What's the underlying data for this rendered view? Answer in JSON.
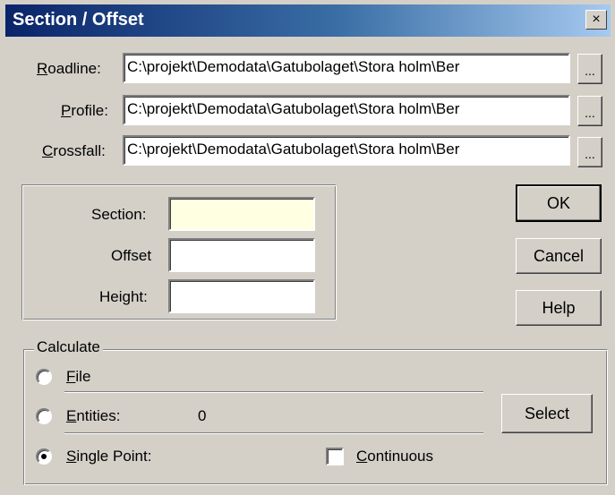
{
  "window": {
    "title": "Section / Offset",
    "close_glyph": "×"
  },
  "files": {
    "roadline_label_key": "R",
    "roadline_label_rest": "oadline:",
    "roadline_value": "C:\\projekt\\Demodata\\Gatubolaget\\Stora holm\\Ber",
    "profile_label_key": "P",
    "profile_label_rest": "rofile:",
    "profile_value": "C:\\projekt\\Demodata\\Gatubolaget\\Stora holm\\Ber",
    "crossfall_label_key": "C",
    "crossfall_label_rest": "rossfall:",
    "crossfall_value": "C:\\projekt\\Demodata\\Gatubolaget\\Stora holm\\Ber",
    "browse_label": "..."
  },
  "position": {
    "section_label": "Section:",
    "section_value": "",
    "offset_label": "Offset",
    "offset_value": "",
    "height_label": "Height:",
    "height_value": ""
  },
  "buttons": {
    "ok": "OK",
    "cancel": "Cancel",
    "help": "Help",
    "select": "Select"
  },
  "calculate": {
    "group_label": "Calculate",
    "file_key": "F",
    "file_rest": "ile",
    "entities_key": "E",
    "entities_rest": "ntities:",
    "entities_count": "0",
    "single_point_key": "S",
    "single_point_rest": "ingle Point:",
    "continuous_key": "C",
    "continuous_rest": "ontinuous",
    "selected_option": "Single Point",
    "continuous_checked": false
  },
  "colors": {
    "dialog_bg": "#d4d0c8",
    "title_gradient_start": "#0a246a",
    "title_gradient_end": "#a6caf0",
    "section_field_bg": "#ffffe1"
  }
}
